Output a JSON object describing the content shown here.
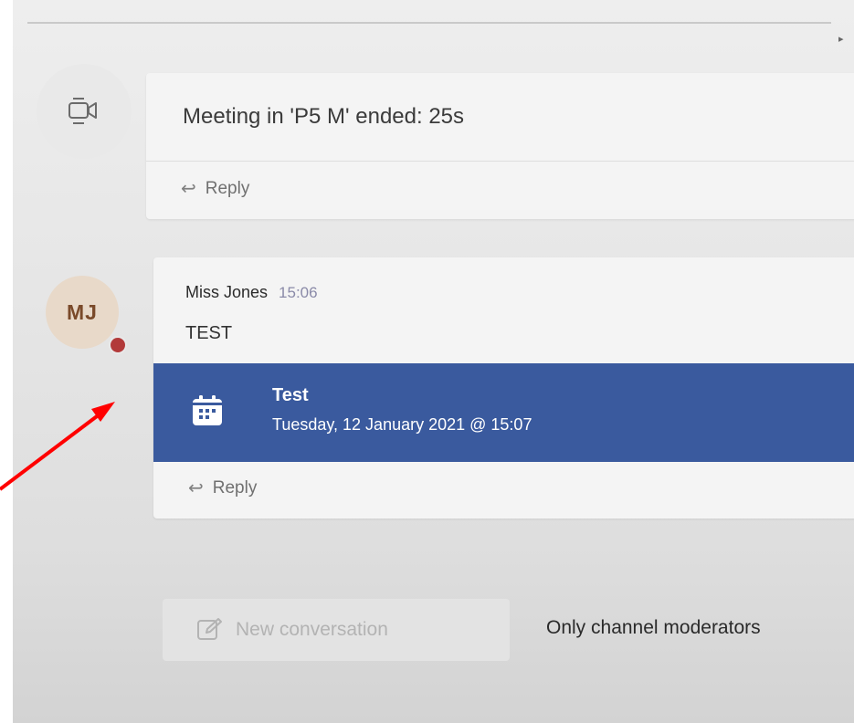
{
  "feed": {
    "meeting_post": {
      "icon": "video-camera-icon",
      "text": "Meeting in 'P5 M' ended: 25s",
      "reply_label": "Reply"
    },
    "message_post": {
      "avatar_initials": "MJ",
      "author": "Miss Jones",
      "time": "15:06",
      "body": "TEST",
      "event": {
        "icon": "calendar-icon",
        "title": "Test",
        "date": "Tuesday, 12 January 2021 @ 15:07"
      },
      "reply_label": "Reply"
    }
  },
  "compose": {
    "new_conversation_label": "New conversation",
    "moderators_notice": "Only channel moderators"
  },
  "colors": {
    "event_card": "#3a5a9e",
    "presence_busy": "#b23a3a",
    "annotation_arrow": "#ff0000"
  }
}
